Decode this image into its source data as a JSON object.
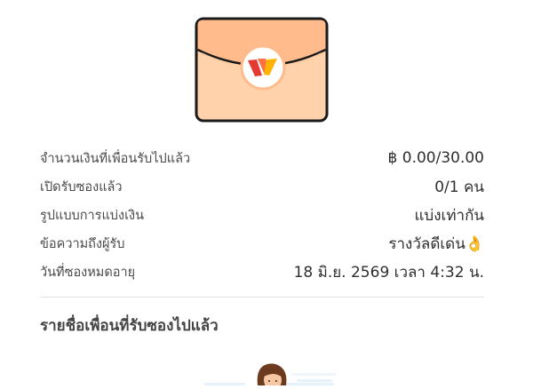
{
  "envelope": {
    "icon": "red-envelope-icon",
    "logo": "wallet-logo-icon",
    "colors": {
      "body": "#ffd2ab",
      "flap": "#ffbb8c",
      "outline": "#1a1a1a",
      "logo_red": "#e53935",
      "logo_orange": "#ffb300"
    }
  },
  "details": [
    {
      "label": "จำนวนเงินที่เพื่อนรับไปแล้ว",
      "value": "฿ 0.00/30.00"
    },
    {
      "label": "เปิดรับซองแล้ว",
      "value": "0/1 คน"
    },
    {
      "label": "รูปแบบการแบ่งเงิน",
      "value": "แบ่งเท่ากัน"
    },
    {
      "label": "ข้อความถึงผู้รับ",
      "value": "รางวัลดีเด่น👌"
    },
    {
      "label": "วันที่ซองหมดอายุ",
      "value": "18 มิ.ย. 2569 เวลา 4:32 น."
    }
  ],
  "recipients": {
    "title": "รายชื่อเพื่อนที่รับซองไปแล้ว",
    "empty_illustration": "person-illustration-icon"
  }
}
